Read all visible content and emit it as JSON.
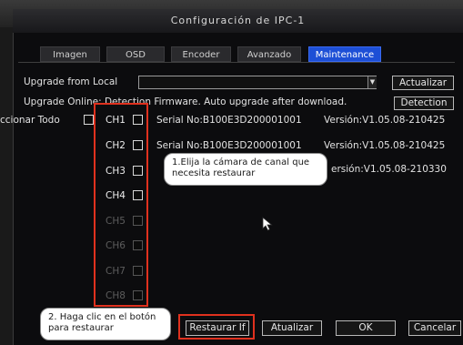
{
  "window": {
    "title": "Configuración de IPC-1"
  },
  "tabs": [
    {
      "label": "Imagen"
    },
    {
      "label": "OSD"
    },
    {
      "label": "Encoder"
    },
    {
      "label": "Avanzado"
    },
    {
      "label": "Maintenance",
      "active": true
    }
  ],
  "upgrade_local": {
    "label": "Upgrade from Local",
    "file_value": "",
    "update_button": "Actualizar"
  },
  "upgrade_online": {
    "label": "Upgrade Online: Detection Firmware. Auto upgrade after download.",
    "detect_button": "Detection"
  },
  "select_all": {
    "label": "ccionar Todo"
  },
  "channels": [
    {
      "label": "CH1",
      "serial": "Serial No:B100E3D200001001",
      "version": "Versión:V1.05.08-210425",
      "enabled": true
    },
    {
      "label": "CH2",
      "serial": "Serial No:B100E3D200001001",
      "version": "Versión:V1.05.08-210425",
      "enabled": true
    },
    {
      "label": "CH3",
      "serial": "",
      "version": "ersión:V1.05.08-210330",
      "enabled": true
    },
    {
      "label": "CH4",
      "serial": "",
      "version": "",
      "enabled": true
    },
    {
      "label": "CH5",
      "serial": "",
      "version": "",
      "enabled": false
    },
    {
      "label": "CH6",
      "serial": "",
      "version": "",
      "enabled": false
    },
    {
      "label": "CH7",
      "serial": "",
      "version": "",
      "enabled": false
    },
    {
      "label": "CH8",
      "serial": "",
      "version": "",
      "enabled": false
    }
  ],
  "buttons": {
    "restore": "Restaurar If",
    "refresh": "Atualizar",
    "ok": "OK",
    "cancel": "Cancelar"
  },
  "callouts": {
    "step1": "1.Elija la cámara de canal que necesita restaurar",
    "step2": "2. Haga clic en el botón para restaurar"
  },
  "colors": {
    "accent_tab": "#1d4fd6",
    "highlight_red": "#e0311e"
  },
  "icons": {
    "pointer": "mouse-pointer-icon"
  }
}
